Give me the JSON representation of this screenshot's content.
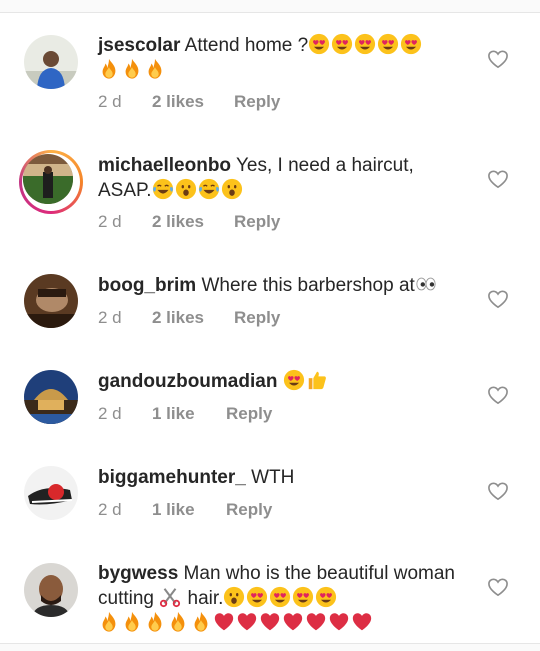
{
  "comments": [
    {
      "user": "jsescolar",
      "text": "Attend home ?",
      "time": "2 d",
      "likes": "2 likes",
      "reply": "Reply"
    },
    {
      "user": "michaelleonbo",
      "text": "Yes, I need a haircut, ASAP.",
      "time": "2 d",
      "likes": "2 likes",
      "reply": "Reply"
    },
    {
      "user": "boog_brim",
      "text": "Where this barbershop at",
      "time": "2 d",
      "likes": "2 likes",
      "reply": "Reply"
    },
    {
      "user": "gandouzboumadian",
      "text": "",
      "time": "2 d",
      "likes": "1 like",
      "reply": "Reply"
    },
    {
      "user": "biggamehunter_",
      "text": "WTH",
      "time": "2 d",
      "likes": "1 like",
      "reply": "Reply"
    },
    {
      "user": "bygwess",
      "text_a": "Man who is the beautiful woman cutting",
      "text_b": "hair.",
      "time": "",
      "likes": "",
      "reply": ""
    }
  ],
  "icons": {
    "heart_outline": "heart-icon",
    "emoji_heart_eyes": "heart-eyes-emoji",
    "emoji_fire": "fire-emoji",
    "emoji_joy": "tears-of-joy-emoji",
    "emoji_open_mouth": "open-mouth-emoji",
    "emoji_eyes": "eyes-emoji",
    "emoji_thumbs_up": "thumbs-up-emoji",
    "emoji_scissors": "scissors-emoji",
    "emoji_red_heart": "red-heart-emoji"
  },
  "colors": {
    "text": "#262626",
    "meta": "#8e8e8e",
    "divider": "#e6e6e6"
  }
}
